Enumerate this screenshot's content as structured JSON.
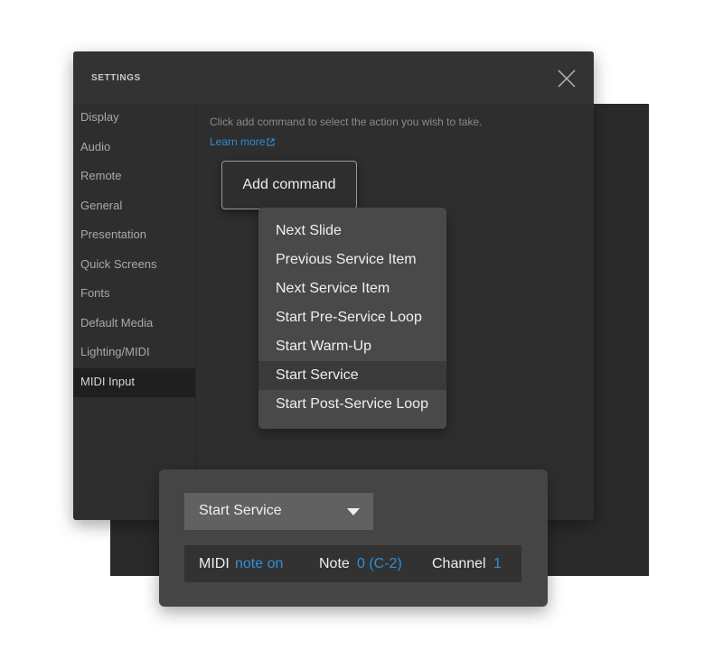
{
  "settings": {
    "title": "SETTINGS",
    "close_icon": "close-icon",
    "sidebar": [
      {
        "label": "Display",
        "active": false
      },
      {
        "label": "Audio",
        "active": false
      },
      {
        "label": "Remote",
        "active": false
      },
      {
        "label": "General",
        "active": false
      },
      {
        "label": "Presentation",
        "active": false
      },
      {
        "label": "Quick Screens",
        "active": false
      },
      {
        "label": "Fonts",
        "active": false
      },
      {
        "label": "Default Media",
        "active": false
      },
      {
        "label": "Lighting/MIDI",
        "active": false
      },
      {
        "label": "MIDI Input",
        "active": true
      }
    ],
    "hint": "Click add command to select the action you wish to take.",
    "learn_more": "Learn more",
    "add_command_label": "Add command"
  },
  "menu": {
    "items": [
      {
        "label": "Next Slide",
        "highlighted": false
      },
      {
        "label": "Previous Service Item",
        "highlighted": false
      },
      {
        "label": "Next Service Item",
        "highlighted": false
      },
      {
        "label": "Start Pre-Service Loop",
        "highlighted": false
      },
      {
        "label": "Start Warm-Up",
        "highlighted": false
      },
      {
        "label": "Start Service",
        "highlighted": true
      },
      {
        "label": "Start Post-Service Loop",
        "highlighted": false
      }
    ]
  },
  "midi_card": {
    "selected_command": "Start Service",
    "midi_label": "MIDI",
    "midi_value": "note on",
    "note_label": "Note",
    "note_value": "0 (C-2)",
    "channel_label": "Channel",
    "channel_value": "1"
  },
  "colors": {
    "accent": "#2d8fd6",
    "window_bg": "#2e2e2e",
    "menu_bg": "#494949",
    "card_bg": "#454545"
  }
}
